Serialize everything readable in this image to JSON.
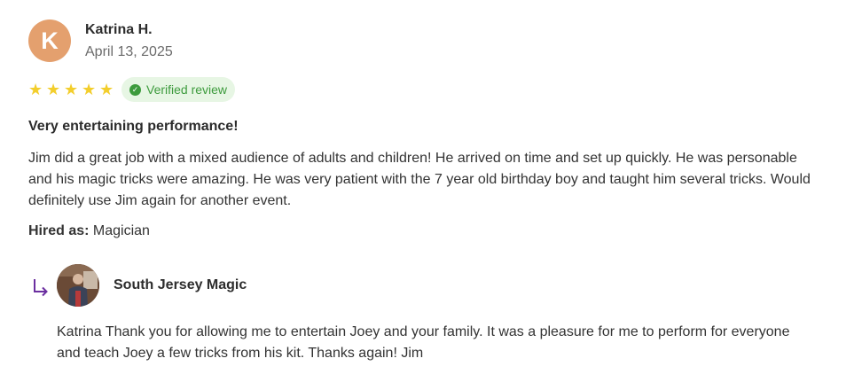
{
  "review": {
    "avatar_initial": "K",
    "reviewer_name": "Katrina H.",
    "date": "April 13, 2025",
    "rating": 5,
    "verified_label": "Verified review",
    "title": "Very entertaining performance!",
    "body": "Jim did a great job with a mixed audience of adults and children! He arrived on time and set up quickly. He was personable and his magic tricks were amazing. He was very patient with the 7 year old birthday boy and taught him several tricks. Would definitely use Jim again for another event.",
    "hired_as_label": "Hired as:",
    "hired_as_value": "Magician"
  },
  "reply": {
    "business_name": "South Jersey Magic",
    "text": "Katrina Thank you for allowing me to entertain Joey and your family. It was a pleasure for me to perform for everyone and teach Joey a few tricks from his kit. Thanks again! Jim"
  },
  "colors": {
    "star": "#f3ce2c",
    "avatar": "#e4a06e",
    "verified_green": "#3d9b3d",
    "verified_bg": "#e7f6e4",
    "reply_arrow": "#6b2fa0"
  },
  "icons": {
    "star": "star-icon",
    "verified": "check-circle-icon",
    "reply": "reply-arrow-icon"
  }
}
